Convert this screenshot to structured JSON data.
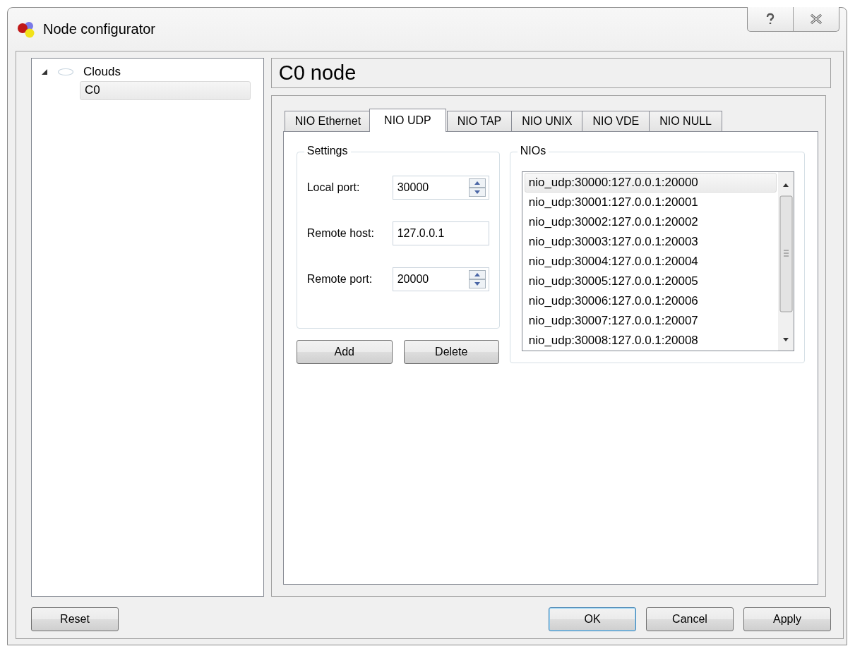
{
  "window": {
    "title": "Node configurator"
  },
  "tree": [
    {
      "label": "Clouds",
      "expanded": true,
      "selected": false,
      "children": [
        {
          "label": "C0",
          "selected": true
        }
      ]
    }
  ],
  "header": "C0 node",
  "tabs": [
    {
      "label": "NIO Ethernet",
      "selected": false
    },
    {
      "label": "NIO UDP",
      "selected": true
    },
    {
      "label": "NIO TAP",
      "selected": false
    },
    {
      "label": "NIO UNIX",
      "selected": false
    },
    {
      "label": "NIO VDE",
      "selected": false
    },
    {
      "label": "NIO NULL",
      "selected": false
    }
  ],
  "settings": {
    "title": "Settings",
    "fields": [
      {
        "kind": "spin",
        "label": "Local port:",
        "value": "30000"
      },
      {
        "kind": "text",
        "label": "Remote host:",
        "value": "127.0.0.1"
      },
      {
        "kind": "spin",
        "label": "Remote port:",
        "value": "20000"
      }
    ],
    "buttons": [
      "Add",
      "Delete"
    ]
  },
  "nios": {
    "title": "NIOs",
    "items": [
      {
        "label": "nio_udp:30000:127.0.0.1:20000",
        "selected": true
      },
      {
        "label": "nio_udp:30001:127.0.0.1:20001",
        "selected": false
      },
      {
        "label": "nio_udp:30002:127.0.0.1:20002",
        "selected": false
      },
      {
        "label": "nio_udp:30003:127.0.0.1:20003",
        "selected": false
      },
      {
        "label": "nio_udp:30004:127.0.0.1:20004",
        "selected": false
      },
      {
        "label": "nio_udp:30005:127.0.0.1:20005",
        "selected": false
      },
      {
        "label": "nio_udp:30006:127.0.0.1:20006",
        "selected": false
      },
      {
        "label": "nio_udp:30007:127.0.0.1:20007",
        "selected": false
      },
      {
        "label": "nio_udp:30008:127.0.0.1:20008",
        "selected": false
      }
    ]
  },
  "footer": {
    "reset": "Reset",
    "buttons": [
      {
        "label": "OK",
        "default": true
      },
      {
        "label": "Cancel",
        "default": false
      },
      {
        "label": "Apply",
        "default": false
      }
    ]
  }
}
